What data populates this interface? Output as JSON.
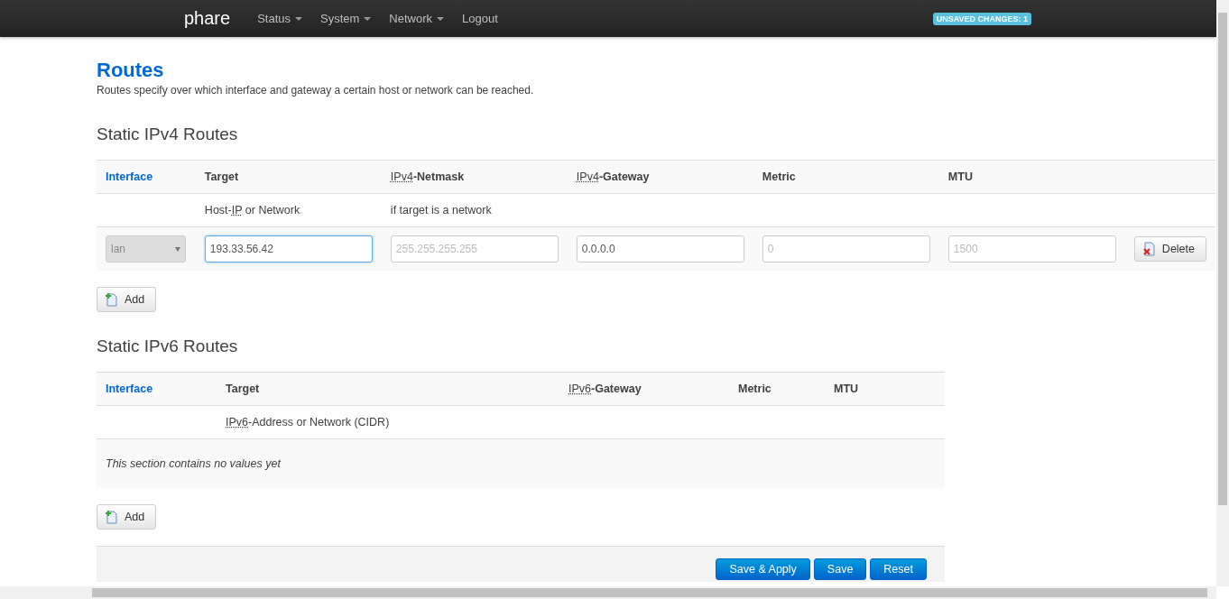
{
  "navbar": {
    "brand": "phare",
    "menu": [
      {
        "label": "Status",
        "dropdown": true
      },
      {
        "label": "System",
        "dropdown": true
      },
      {
        "label": "Network",
        "dropdown": true
      },
      {
        "label": "Logout",
        "dropdown": false
      }
    ],
    "badge": "UNSAVED CHANGES: 1"
  },
  "page": {
    "title": "Routes",
    "description": "Routes specify over which interface and gateway a certain host or network can be reached."
  },
  "ipv4": {
    "heading": "Static IPv4 Routes",
    "columns": [
      {
        "label": "Interface",
        "link": true
      },
      {
        "label": "Target",
        "link": false
      },
      {
        "abbr": "IPv4",
        "label": "-Netmask",
        "link": false
      },
      {
        "abbr": "IPv4",
        "label": "-Gateway",
        "link": false
      },
      {
        "label": "Metric",
        "link": false
      },
      {
        "label": "MTU",
        "link": false
      }
    ],
    "hints": [
      {
        "prefix": "Host-",
        "abbr": "IP",
        "label": " or Network"
      },
      {
        "label": "if target is a network"
      }
    ],
    "rows": [
      {
        "interface": "lan",
        "target": "193.33.56.42",
        "netmask_placeholder": "255.255.255.255",
        "gateway": "0.0.0.0",
        "metric_placeholder": "0",
        "mtu_placeholder": "1500",
        "delete": "Delete"
      }
    ],
    "add": "Add"
  },
  "ipv6": {
    "heading": "Static IPv6 Routes",
    "columns": [
      {
        "label": "Interface",
        "link": true
      },
      {
        "label": "Target",
        "link": false
      },
      {
        "abbr": "IPv6",
        "label": "-Gateway",
        "link": false
      },
      {
        "label": "Metric",
        "link": false
      },
      {
        "label": "MTU",
        "link": false
      }
    ],
    "target_hint": {
      "abbr": "IPv6",
      "label": "-Address or Network (CIDR)"
    },
    "empty": "This section contains no values yet",
    "add": "Add"
  },
  "footer": {
    "buttons": [
      "Save & Apply",
      "Save",
      "Reset"
    ]
  }
}
